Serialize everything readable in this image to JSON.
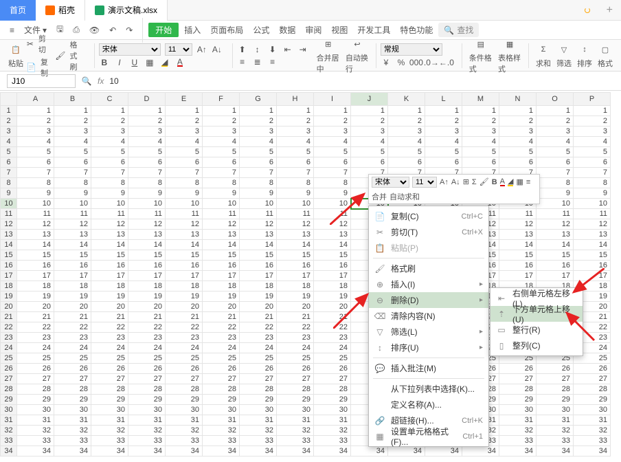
{
  "titlebar": {
    "tabs": [
      {
        "label": "首页"
      },
      {
        "label": "稻壳"
      },
      {
        "label": "演示文稿.xlsx"
      }
    ]
  },
  "menubar": {
    "file": "文件",
    "start": "开始",
    "items": [
      "插入",
      "页面布局",
      "公式",
      "数据",
      "审阅",
      "视图",
      "开发工具",
      "特色功能"
    ],
    "search": "查找"
  },
  "ribbon": {
    "cut": "剪切",
    "copy": "复制",
    "paste": "粘贴",
    "formatpainter": "格式刷",
    "font": "宋体",
    "size": "11",
    "merge": "合并居中",
    "wrap": "自动换行",
    "general": "常规",
    "condfmt": "条件格式",
    "tablefmt": "表格样式",
    "sum": "求和",
    "filter": "筛选",
    "sort": "排序",
    "format": "格式"
  },
  "namebox": {
    "cell": "J10",
    "value": "10"
  },
  "columns": [
    "A",
    "B",
    "C",
    "D",
    "E",
    "F",
    "G",
    "H",
    "I",
    "J",
    "K",
    "L",
    "M",
    "N",
    "O",
    "P"
  ],
  "row_count": 34,
  "selected": {
    "row": 10,
    "col": 10
  },
  "mini": {
    "font": "宋体",
    "size": "11",
    "merge": "合并",
    "autosum": "自动求和"
  },
  "contextmenu": {
    "items": [
      {
        "label": "复制(C)",
        "shortcut": "Ctrl+C",
        "icon": "copy"
      },
      {
        "label": "剪切(T)",
        "shortcut": "Ctrl+X",
        "icon": "cut"
      },
      {
        "label": "粘贴(P)",
        "shortcut": "",
        "icon": "paste",
        "disabled": true
      },
      {
        "sep": true
      },
      {
        "label": "格式刷",
        "icon": "brush"
      },
      {
        "label": "插入(I)",
        "icon": "insert",
        "arrow": true
      },
      {
        "label": "删除(D)",
        "icon": "delete",
        "highlight": true,
        "arrow": true
      },
      {
        "label": "清除内容(N)",
        "icon": "clear"
      },
      {
        "label": "筛选(L)",
        "icon": "filter",
        "arrow": true
      },
      {
        "label": "排序(U)",
        "icon": "sort",
        "arrow": true
      },
      {
        "sep": true
      },
      {
        "label": "插入批注(M)",
        "icon": "comment"
      },
      {
        "sep": true
      },
      {
        "label": "从下拉列表中选择(K)..."
      },
      {
        "label": "定义名称(A)..."
      },
      {
        "label": "超链接(H)...",
        "shortcut": "Ctrl+K",
        "icon": "link"
      },
      {
        "label": "设置单元格格式(F)...",
        "shortcut": "Ctrl+1",
        "icon": "cellformat"
      }
    ]
  },
  "submenu": {
    "items": [
      {
        "label": "右侧单元格左移(L)",
        "icon": "shift-left"
      },
      {
        "label": "下方单元格上移(U)",
        "icon": "shift-up",
        "highlight": true
      },
      {
        "label": "整行(R)",
        "icon": "row"
      },
      {
        "label": "整列(C)",
        "icon": "col"
      }
    ]
  }
}
